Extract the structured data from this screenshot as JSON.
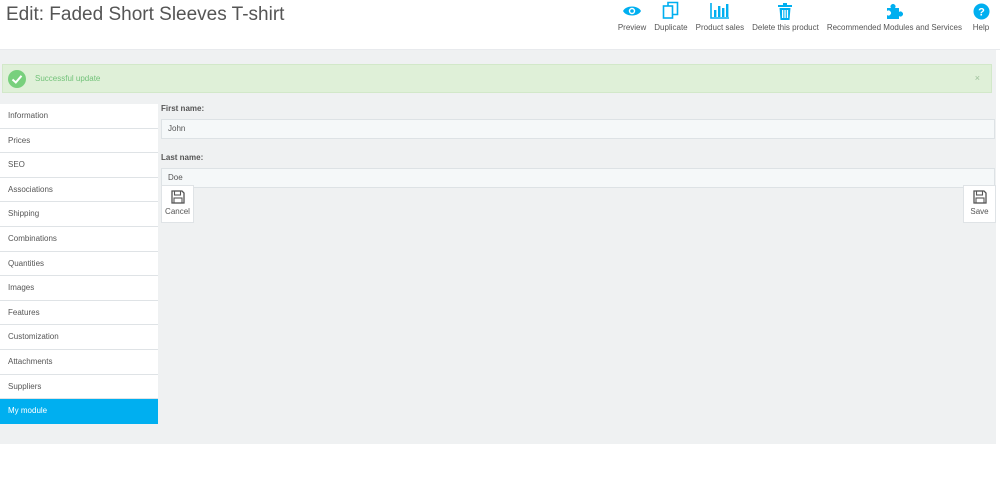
{
  "header": {
    "title": "Edit: Faded Short Sleeves T-shirt",
    "toolbar": [
      {
        "label": "Preview",
        "icon": "eye-icon"
      },
      {
        "label": "Duplicate",
        "icon": "copy-icon"
      },
      {
        "label": "Product sales",
        "icon": "bar-chart-icon"
      },
      {
        "label": "Delete this product",
        "icon": "trash-icon"
      },
      {
        "label": "Recommended Modules and Services",
        "icon": "puzzle-icon"
      },
      {
        "label": "Help",
        "icon": "question-icon"
      }
    ]
  },
  "alert": {
    "message": "Successful update",
    "close": "×"
  },
  "tabs": [
    {
      "label": "Information"
    },
    {
      "label": "Prices"
    },
    {
      "label": "SEO"
    },
    {
      "label": "Associations"
    },
    {
      "label": "Shipping"
    },
    {
      "label": "Combinations"
    },
    {
      "label": "Quantities"
    },
    {
      "label": "Images"
    },
    {
      "label": "Features"
    },
    {
      "label": "Customization"
    },
    {
      "label": "Attachments"
    },
    {
      "label": "Suppliers"
    },
    {
      "label": "My module"
    }
  ],
  "active_tab": "My module",
  "form": {
    "first_name_label": "First name:",
    "first_name_value": "John",
    "last_name_label": "Last name:",
    "last_name_value": "Doe",
    "cancel_label": "Cancel",
    "save_label": "Save"
  },
  "colors": {
    "accent": "#00aff0",
    "success_bg": "#dff0d8",
    "success_text": "#72c279",
    "check": "#78d07d"
  }
}
